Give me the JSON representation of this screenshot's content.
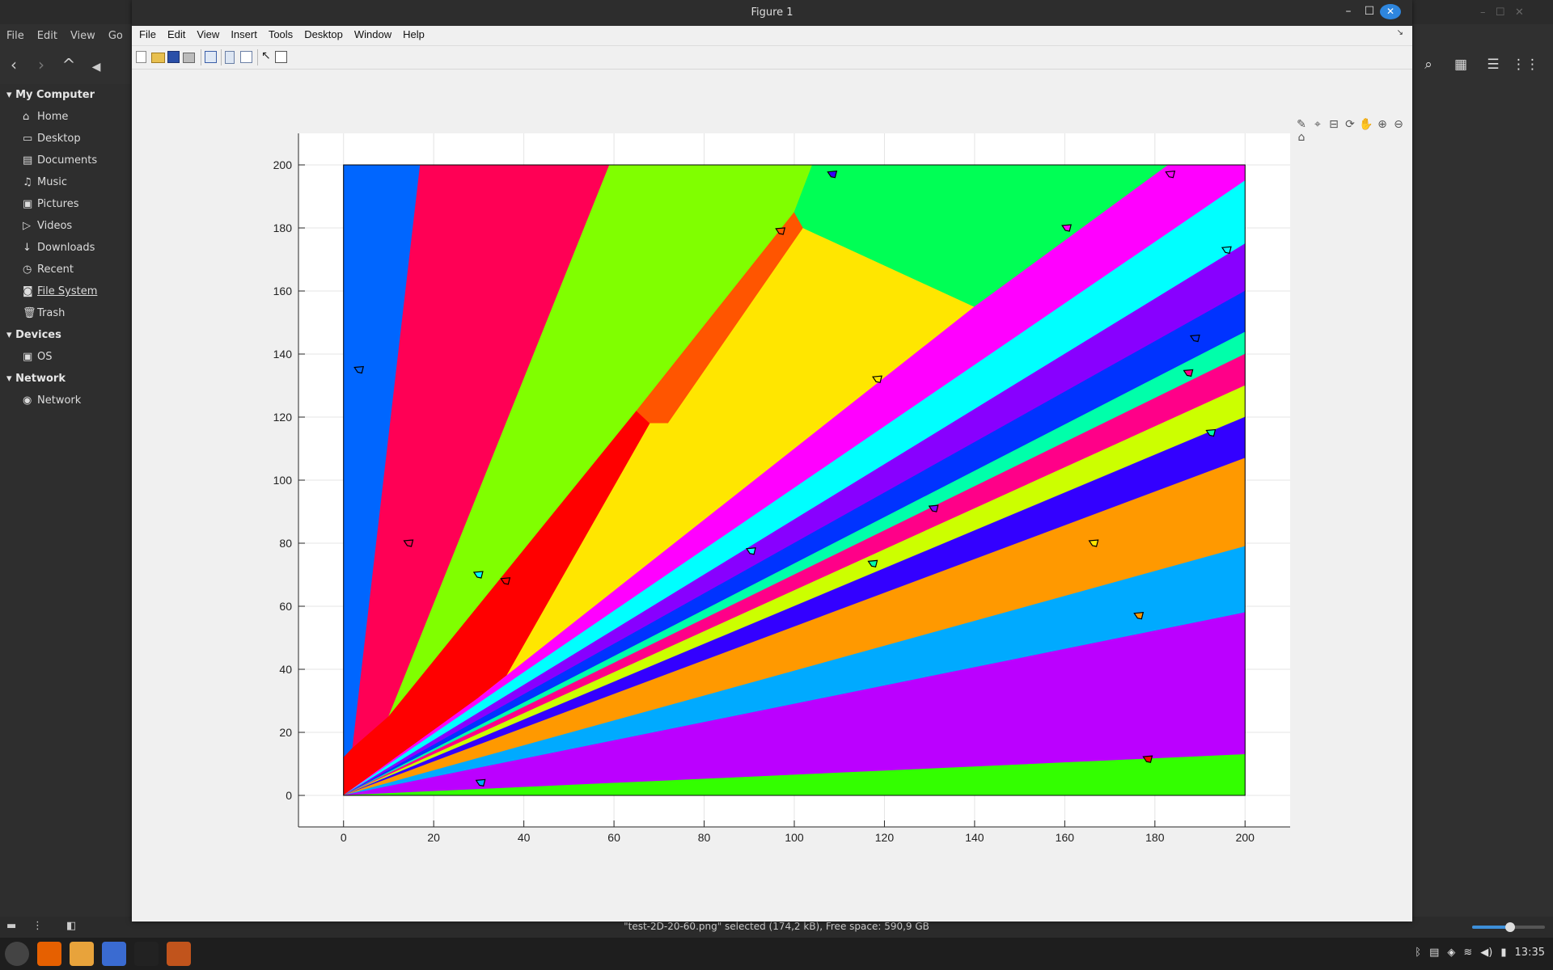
{
  "file_manager": {
    "menu": [
      "File",
      "Edit",
      "View",
      "Go"
    ],
    "sidebar": {
      "sections": [
        {
          "label": "My Computer",
          "items": [
            {
              "label": "Home",
              "icon": "home-icon"
            },
            {
              "label": "Desktop",
              "icon": "desktop-icon"
            },
            {
              "label": "Documents",
              "icon": "documents-icon"
            },
            {
              "label": "Music",
              "icon": "music-icon"
            },
            {
              "label": "Pictures",
              "icon": "pictures-icon"
            },
            {
              "label": "Videos",
              "icon": "videos-icon"
            },
            {
              "label": "Downloads",
              "icon": "downloads-icon"
            },
            {
              "label": "Recent",
              "icon": "recent-icon"
            },
            {
              "label": "File System",
              "icon": "filesystem-icon"
            },
            {
              "label": "Trash",
              "icon": "trash-icon"
            }
          ]
        },
        {
          "label": "Devices",
          "items": [
            {
              "label": "OS",
              "icon": "drive-icon"
            }
          ]
        },
        {
          "label": "Network",
          "items": [
            {
              "label": "Network",
              "icon": "network-icon"
            }
          ]
        }
      ]
    },
    "status_text": "\"test-2D-20-60.png\" selected (174,2 kB), Free space: 590,9 GB"
  },
  "figure": {
    "title": "Figure 1",
    "menu": [
      "File",
      "Edit",
      "View",
      "Insert",
      "Tools",
      "Desktop",
      "Window",
      "Help"
    ]
  },
  "chart_data": {
    "type": "heatmap",
    "title": "",
    "xlabel": "",
    "ylabel": "",
    "xlim": [
      -10,
      210
    ],
    "ylim": [
      -10,
      210
    ],
    "xticks": [
      "0",
      "20",
      "40",
      "60",
      "80",
      "100",
      "120",
      "140",
      "160",
      "180",
      "200"
    ],
    "yticks": [
      "0",
      "20",
      "40",
      "60",
      "80",
      "100",
      "120",
      "140",
      "160",
      "180",
      "200"
    ],
    "grid": true,
    "regions": [
      {
        "color": "#0066ff",
        "polygon": [
          [
            0,
            200
          ],
          [
            17,
            200
          ],
          [
            2,
            15
          ],
          [
            0,
            12
          ]
        ]
      },
      {
        "color": "#ff0055",
        "polygon": [
          [
            17,
            200
          ],
          [
            59,
            200
          ],
          [
            10,
            25
          ],
          [
            2,
            15
          ]
        ]
      },
      {
        "color": "#80ff00",
        "polygon": [
          [
            59,
            200
          ],
          [
            104,
            200
          ],
          [
            100,
            185
          ],
          [
            65,
            122
          ],
          [
            10,
            25
          ]
        ]
      },
      {
        "color": "#ff0000",
        "polygon": [
          [
            0,
            12
          ],
          [
            2,
            15
          ],
          [
            10,
            25
          ],
          [
            65,
            122
          ],
          [
            68,
            118
          ],
          [
            35,
            35
          ],
          [
            0,
            0
          ]
        ]
      },
      {
        "color": "#ff5500",
        "polygon": [
          [
            65,
            122
          ],
          [
            100,
            185
          ],
          [
            102,
            180
          ],
          [
            72,
            118
          ],
          [
            68,
            118
          ]
        ]
      },
      {
        "color": "#ffe600",
        "polygon": [
          [
            72,
            118
          ],
          [
            102,
            180
          ],
          [
            105,
            178
          ],
          [
            140,
            155
          ],
          [
            30,
            31
          ],
          [
            35,
            35
          ],
          [
            68,
            118
          ]
        ]
      },
      {
        "color": "#00ff55",
        "polygon": [
          [
            104,
            200
          ],
          [
            183,
            200
          ],
          [
            140,
            155
          ],
          [
            105,
            178
          ],
          [
            102,
            180
          ],
          [
            100,
            185
          ]
        ]
      },
      {
        "color": "#ff00ff",
        "polygon": [
          [
            183,
            200
          ],
          [
            200,
            200
          ],
          [
            200,
            195
          ],
          [
            0,
            0
          ],
          [
            30,
            31
          ],
          [
            140,
            155
          ]
        ]
      },
      {
        "color": "#00ffff",
        "polygon": [
          [
            200,
            195
          ],
          [
            200,
            175
          ],
          [
            0,
            0
          ]
        ]
      },
      {
        "color": "#8800ff",
        "polygon": [
          [
            200,
            175
          ],
          [
            200,
            160
          ],
          [
            0,
            0
          ]
        ]
      },
      {
        "color": "#0033ff",
        "polygon": [
          [
            200,
            160
          ],
          [
            200,
            147
          ],
          [
            0,
            0
          ]
        ]
      },
      {
        "color": "#00ffaa",
        "polygon": [
          [
            200,
            147
          ],
          [
            200,
            140
          ],
          [
            0,
            0
          ]
        ]
      },
      {
        "color": "#ff0088",
        "polygon": [
          [
            200,
            140
          ],
          [
            200,
            130
          ],
          [
            0,
            0
          ]
        ]
      },
      {
        "color": "#ccff00",
        "polygon": [
          [
            200,
            130
          ],
          [
            200,
            120
          ],
          [
            0,
            0
          ]
        ]
      },
      {
        "color": "#3300ff",
        "polygon": [
          [
            200,
            120
          ],
          [
            200,
            107
          ],
          [
            0,
            0
          ]
        ]
      },
      {
        "color": "#ff9900",
        "polygon": [
          [
            200,
            107
          ],
          [
            200,
            79
          ],
          [
            0,
            0
          ]
        ]
      },
      {
        "color": "#00aaff",
        "polygon": [
          [
            200,
            79
          ],
          [
            200,
            58
          ],
          [
            0,
            0
          ]
        ]
      },
      {
        "color": "#bb00ff",
        "polygon": [
          [
            200,
            58
          ],
          [
            200,
            13
          ],
          [
            0,
            0
          ]
        ]
      },
      {
        "color": "#33ff00",
        "polygon": [
          [
            200,
            13
          ],
          [
            200,
            0
          ],
          [
            0,
            0
          ]
        ]
      }
    ],
    "markers": [
      {
        "x": 3.5,
        "y": 135,
        "color": "#0066ff"
      },
      {
        "x": 14.5,
        "y": 80,
        "color": "#ff0055"
      },
      {
        "x": 30,
        "y": 70,
        "color": "#00ffff"
      },
      {
        "x": 36,
        "y": 68,
        "color": "#ff0000"
      },
      {
        "x": 97,
        "y": 179,
        "color": "#ff5500"
      },
      {
        "x": 108.5,
        "y": 197,
        "color": "#3300ff"
      },
      {
        "x": 118.5,
        "y": 132,
        "color": "#ffe600"
      },
      {
        "x": 160.5,
        "y": 180,
        "color": "#ff00ff"
      },
      {
        "x": 183.5,
        "y": 197,
        "color": "#ff00ff"
      },
      {
        "x": 196,
        "y": 173,
        "color": "#00ffff"
      },
      {
        "x": 187.5,
        "y": 134,
        "color": "#ff0088"
      },
      {
        "x": 189,
        "y": 145,
        "color": "#0033ff"
      },
      {
        "x": 192.5,
        "y": 115,
        "color": "#00ffaa"
      },
      {
        "x": 131,
        "y": 91,
        "color": "#8800ff"
      },
      {
        "x": 90.5,
        "y": 77.5,
        "color": "#00ffff"
      },
      {
        "x": 117.5,
        "y": 73.5,
        "color": "#00ffaa"
      },
      {
        "x": 166.5,
        "y": 80,
        "color": "#ffe600"
      },
      {
        "x": 176.5,
        "y": 57,
        "color": "#ff9900"
      },
      {
        "x": 30.5,
        "y": 4,
        "color": "#00aaff"
      },
      {
        "x": 178.5,
        "y": 11.5,
        "color": "#ff0000"
      }
    ]
  },
  "taskbar": {
    "apps": [
      {
        "name": "mint-menu-icon",
        "color": "#444444"
      },
      {
        "name": "firefox-icon",
        "color": "#e66000"
      },
      {
        "name": "files-icon",
        "color": "#e8a33b"
      },
      {
        "name": "mail-icon",
        "color": "#3a6bd1"
      },
      {
        "name": "terminal-icon",
        "color": "#222222"
      },
      {
        "name": "matlab-icon",
        "color": "#c1541c"
      }
    ],
    "clock": "13:35"
  }
}
